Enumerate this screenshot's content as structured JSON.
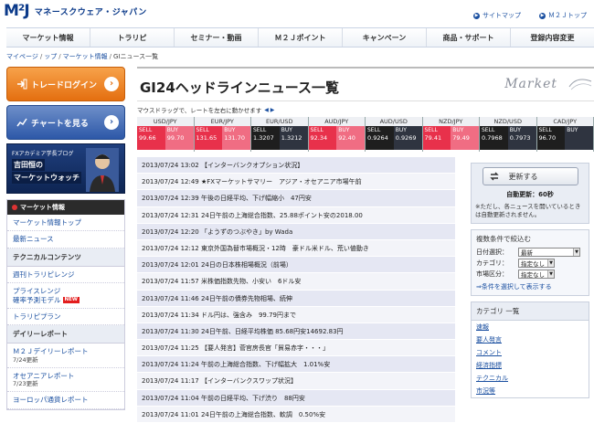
{
  "header": {
    "logo_mark": "M²J",
    "logo_text": "マネースクウェア・ジャパン",
    "links": [
      "サイトマップ",
      "Ｍ２Ｊトップ"
    ]
  },
  "nav": [
    "マーケット情報",
    "トラリピ",
    "セミナー・動画",
    "Ｍ２Ｊポイント",
    "キャンペーン",
    "商品・サポート",
    "登録内容変更"
  ],
  "breadcrumb": [
    "マイページ",
    "ップ",
    "マーケット情報",
    "GIニュース一覧"
  ],
  "left": {
    "trade_login": "トレードログイン",
    "chart_view": "チャートを見る",
    "banner_line1": "FXアカデミア学長ブログ",
    "banner_line2": "吉田恒の",
    "banner_line3": "マーケットウォッチ",
    "menu_header": "マーケット情報",
    "items": [
      {
        "label": "マーケット情報トップ",
        "sub": ""
      },
      {
        "label": "最新ニュース",
        "sub": ""
      }
    ],
    "section1": "テクニカルコンテンツ",
    "tech_items": [
      {
        "label": "週刊トラリピレンジ",
        "sub": ""
      },
      {
        "label": "プライスレンジ",
        "sub": "確率予測モデル"
      },
      {
        "label": "トラリピプラン",
        "sub": ""
      }
    ],
    "new_badge": "NEW",
    "section2": "デイリーレポート",
    "daily_items": [
      {
        "label": "Ｍ２Ｊデイリーレポート",
        "sub": "7/24更新"
      },
      {
        "label": "オセアニアレポート",
        "sub": "7/23更新"
      },
      {
        "label": "ヨーロッパ通貨レポート",
        "sub": ""
      }
    ]
  },
  "main": {
    "title": "GI24ヘッドラインニュース一覧",
    "market_logo": "Market",
    "rate_note": "マウスドラッグで、レートを左右に動かせます",
    "rates": [
      {
        "pair": "USD/JPY",
        "sell": "99.66",
        "buy": "99.70",
        "style": [
          "red",
          "pink"
        ]
      },
      {
        "pair": "EUR/JPY",
        "sell": "131.65",
        "buy": "131.70",
        "style": [
          "red",
          "pink"
        ]
      },
      {
        "pair": "EUR/USD",
        "sell": "1.3207",
        "buy": "1.3212",
        "style": [
          "dk",
          "mid"
        ]
      },
      {
        "pair": "AUD/JPY",
        "sell": "92.34",
        "buy": "92.40",
        "style": [
          "red",
          "pink"
        ]
      },
      {
        "pair": "AUD/USD",
        "sell": "0.9264",
        "buy": "0.9269",
        "style": [
          "dk",
          "mid"
        ]
      },
      {
        "pair": "NZD/JPY",
        "sell": "79.41",
        "buy": "79.49",
        "style": [
          "red",
          "pink"
        ]
      },
      {
        "pair": "NZD/USD",
        "sell": "0.7968",
        "buy": "0.7973",
        "style": [
          "dk",
          "mid"
        ]
      },
      {
        "pair": "CAD/JPY",
        "sell": "96.70",
        "buy": "",
        "style": [
          "dk",
          "mid"
        ]
      }
    ],
    "sell_label": "SELL",
    "buy_label": "BUY",
    "news": [
      "2013/07/24 13:02 【インターバンクオプション状況】",
      "2013/07/24 12:49 ★FXマーケットサマリー　アジア・オセアニア市場午前",
      "2013/07/24 12:39 午後の日経平均、下げ幅縮小　47円安",
      "2013/07/24 12:31 24日午前の上海総合指数、25.88ポイント安の2018.00",
      "2013/07/24 12:20 「ようずのつぶやき」by Wada",
      "2013/07/24 12:12 東京外国為替市場概況・12時　豪ドル米ドル、荒い値動き",
      "2013/07/24 12:01 24日の日本株相場概況（前場）",
      "2013/07/24 11:57 米株価指数先物、小安い　6ドル安",
      "2013/07/24 11:46 24日午前の債券先物相場、続伸",
      "2013/07/24 11:34 ドル円は、強含み　99.79円まで",
      "2013/07/24 11:30 24日午前、日経平均株価 85.68円安14692.83円",
      "2013/07/24 11:25 【要人発言】菅官房長官「貿易赤字・・・」",
      "2013/07/24 11:24 午前の上海総合指数、下げ幅拡大　1.01%安",
      "2013/07/24 11:17 【インターバンクスワップ状況】",
      "2013/07/24 11:04 午前の日経平均、下げ渋り　88円安",
      "2013/07/24 11:01 24日午前の上海総合指数、軟調　0.50%安"
    ]
  },
  "right": {
    "refresh": "更新する",
    "auto_update": "自動更新：60秒",
    "note": "※ただし、各ニュースを開いているときは自動更新されません。",
    "filter_title": "複数条件で絞込む",
    "filters": [
      {
        "label": "日付選択：",
        "value": "最新"
      },
      {
        "label": "カテゴリ：",
        "value": "指定なし"
      },
      {
        "label": "市場区分：",
        "value": "指定なし"
      }
    ],
    "filter_link": "⇒条件を選択して表示する",
    "cat_title": "カテゴリ 一覧",
    "categories": [
      "速報",
      "要人発言",
      "コメント",
      "経済指標",
      "テクニカル",
      "市況等"
    ]
  }
}
